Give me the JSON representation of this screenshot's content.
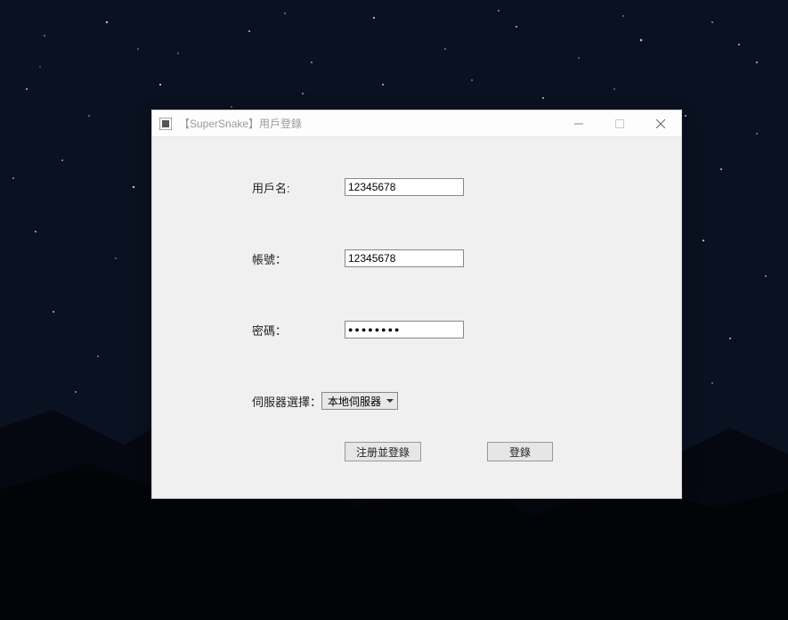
{
  "window": {
    "title": "【SuperSnake】用戶登錄"
  },
  "form": {
    "username_label": "用戶名:",
    "username_value": "12345678",
    "account_label": "帳號：",
    "account_value": "12345678",
    "password_label": "密碼：",
    "password_value": "●●●●●●●●",
    "server_label": "伺服器選擇：",
    "server_selected": "本地伺服器"
  },
  "buttons": {
    "register_login": "注册並登錄",
    "login": "登錄"
  }
}
